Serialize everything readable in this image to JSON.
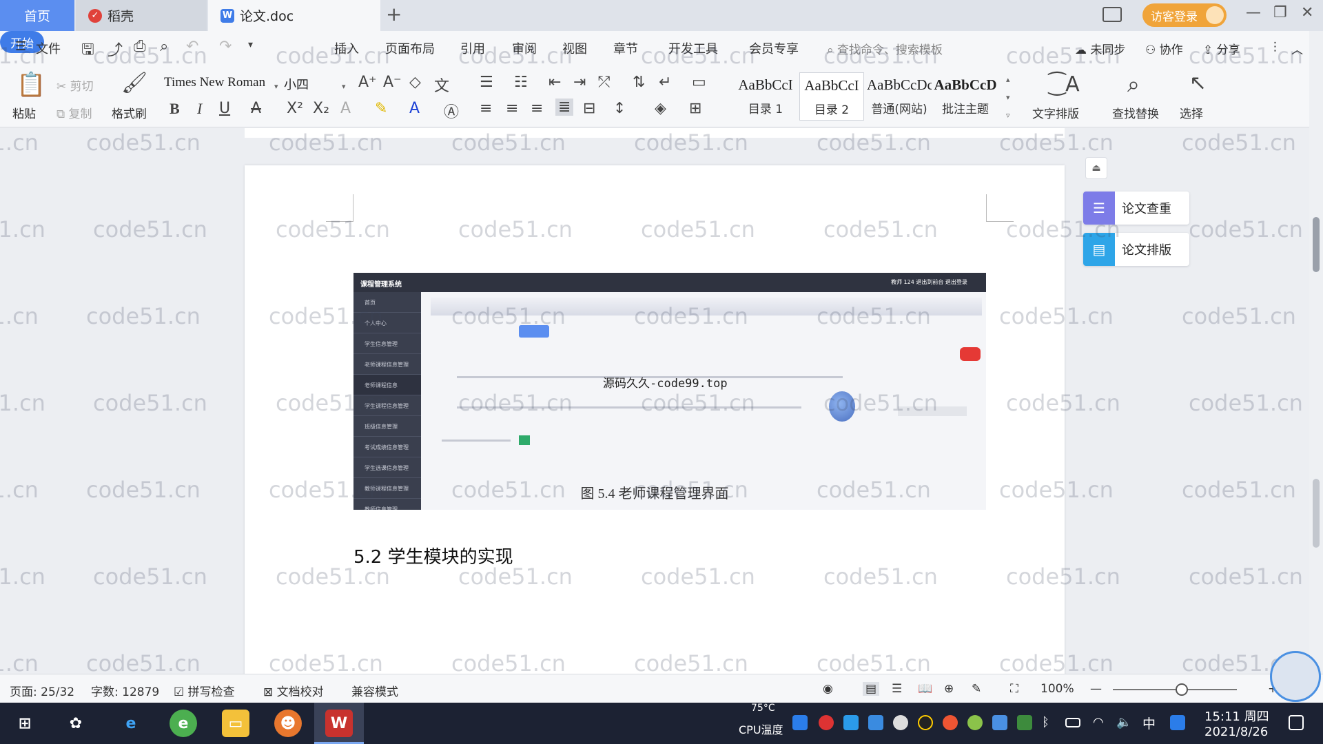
{
  "tabs": {
    "home": "首页",
    "daoke": "稻壳",
    "doc": "论文.doc",
    "guest_login": "访客登录"
  },
  "ribbon": {
    "file": "文件",
    "tabs": [
      "开始",
      "插入",
      "页面布局",
      "引用",
      "审阅",
      "视图",
      "章节",
      "开发工具",
      "会员专享"
    ],
    "search_placeholder": "查找命令、搜索模板",
    "unsynced": "未同步",
    "collaborate": "协作",
    "share": "分享"
  },
  "toolbar": {
    "paste": "粘贴",
    "cut": "剪切",
    "copy": "复制",
    "format_painter": "格式刷",
    "font_name": "Times New Roman",
    "font_size": "小四",
    "styles": [
      {
        "sample": "AaBbCcI",
        "name": "目录 1"
      },
      {
        "sample": "AaBbCcI",
        "name": "目录 2"
      },
      {
        "sample": "AaBbCcDc",
        "name": "普通(网站)"
      },
      {
        "sample": "AaBbCcD",
        "name": "批注主题"
      }
    ],
    "text_layout": "文字排版",
    "find_replace": "查找替换",
    "select": "选择"
  },
  "side_panel": {
    "check": "论文查重",
    "layout": "论文排版"
  },
  "figure": {
    "app_title": "课程管理系统",
    "header_right": "教师 124   退出到前台   退出登录",
    "sidebar_items": [
      "首页",
      "个人中心",
      "学生信息管理",
      "老师课程信息管理",
      "老师课程信息",
      "学生课程信息管理",
      "班级信息管理",
      "考试成绩信息管理",
      "学生选课信息管理",
      "教师课程信息管理",
      "教师信息管理"
    ],
    "watermark": "源码久久-code99.top",
    "caption": "图 5.4  老师课程管理界面"
  },
  "section_heading": "5.2  学生模块的实现",
  "watermark_text": "code51.cn",
  "status": {
    "page": "页面: 25/32",
    "words": "字数: 12879",
    "spell": "拼写检查",
    "proofread": "文档校对",
    "compat": "兼容模式",
    "zoom": "100%"
  },
  "taskbar": {
    "cpu_temp": "75°C",
    "cpu_label": "CPU温度",
    "ime": "中",
    "time": "15:11 周四",
    "date": "2021/8/26"
  },
  "colors": {
    "accent": "#3f7ce8",
    "home_tab": "#5b8ef0",
    "guest_login": "#f0a43a",
    "wps_red": "#c8322e"
  }
}
